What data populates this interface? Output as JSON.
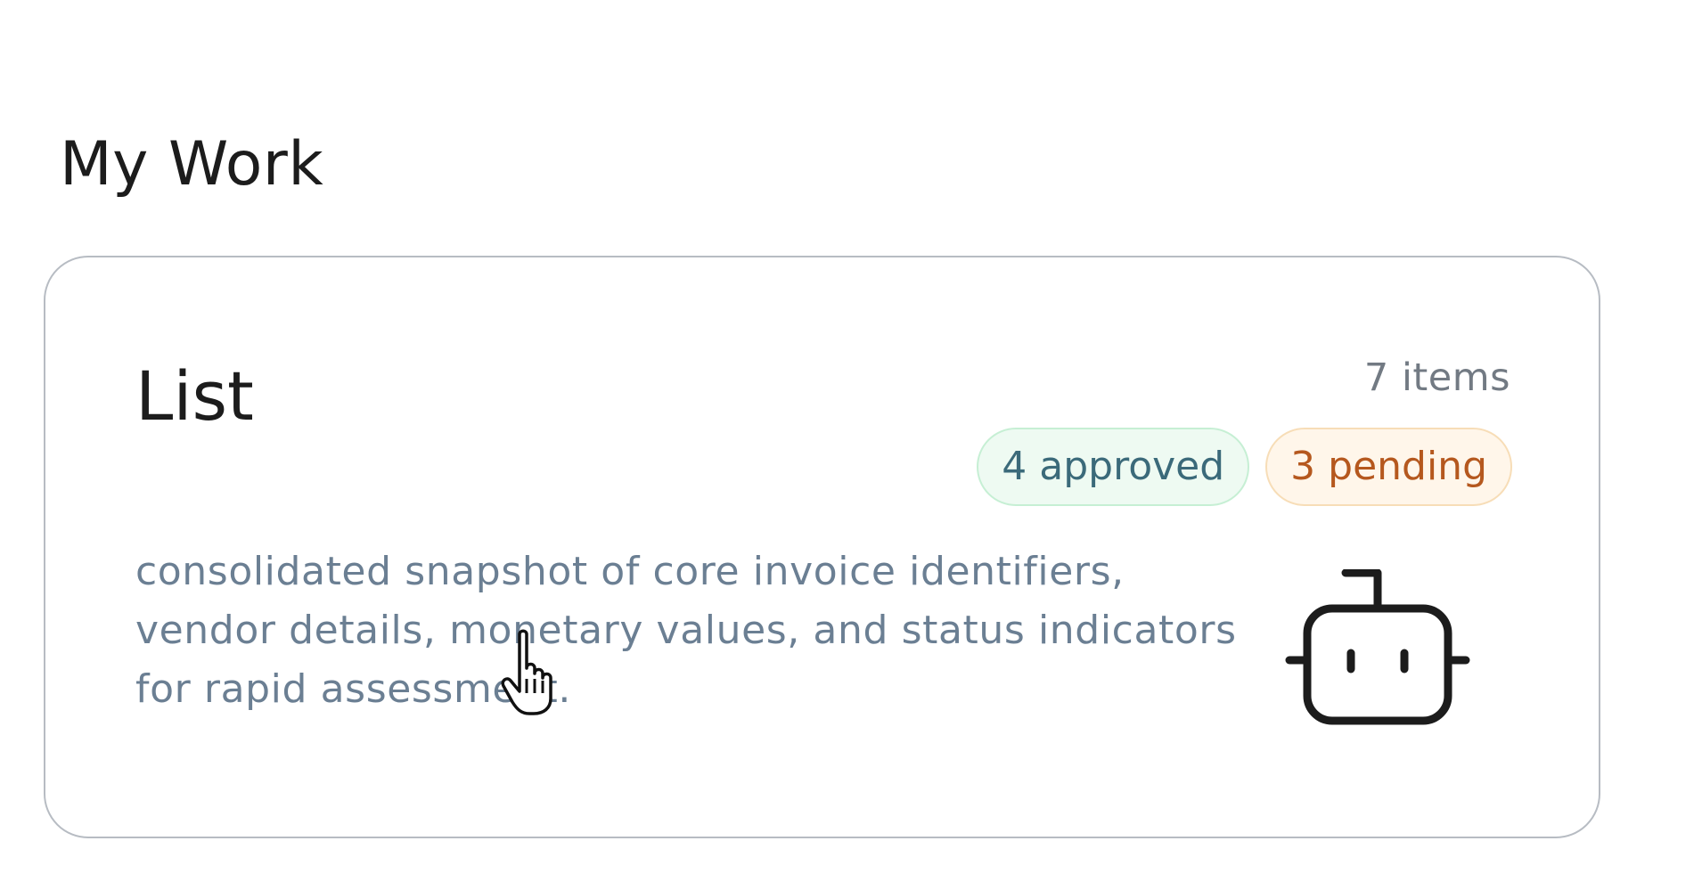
{
  "page": {
    "title": "My Work"
  },
  "card": {
    "title": "List",
    "item_count": "7 items",
    "badges": {
      "approved": "4 approved",
      "pending": "3 pending"
    },
    "description": "consolidated snapshot of core invoice identifiers, vendor details, monetary values, and status indicators for rapid assessment.",
    "icon": "robot-icon"
  },
  "colors": {
    "card_border": "#b7bcc3",
    "approved_bg": "#eefaf2",
    "approved_text": "#3b6a7a",
    "pending_bg": "#fff6ea",
    "pending_text": "#b5581e",
    "description_text": "#6b7f93",
    "meta_text": "#727a83"
  },
  "cursor": {
    "icon": "hand-pointer-cursor-icon"
  }
}
